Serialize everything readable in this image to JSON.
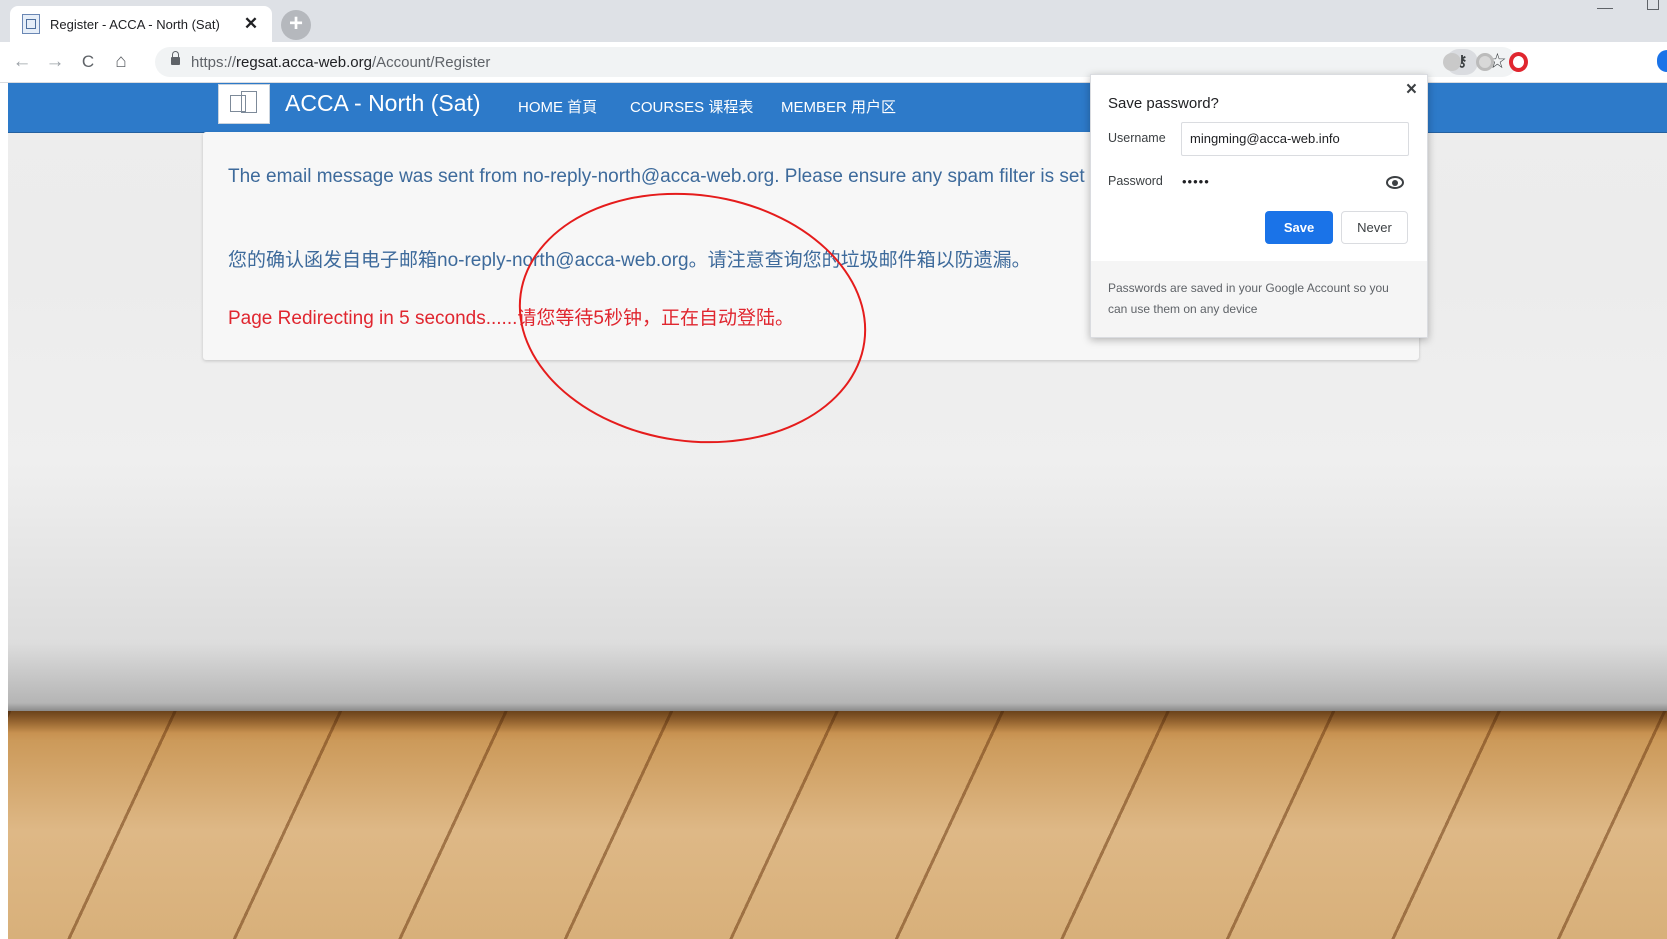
{
  "browser": {
    "tab": {
      "title": "Register - ACCA - North (Sat)",
      "close": "✕"
    },
    "newtab": "+",
    "nav": {
      "back": "←",
      "forward": "→",
      "reload": "C",
      "home": "⌂"
    },
    "url": {
      "scheme": "https://",
      "host": "regsat.acca-web.org",
      "path": "/Account/Register"
    },
    "toolbar_icons": {
      "key": "⚷",
      "star": "☆"
    }
  },
  "site": {
    "brand": "ACCA - North (Sat)",
    "nav": [
      {
        "label": "HOME 首頁"
      },
      {
        "label": "COURSES 课程表"
      },
      {
        "label": "MEMBER 用户区"
      }
    ]
  },
  "message": {
    "english": "The email message was sent from no-reply-north@acca-web.org. Please ensure any spam filter is set to allow mail from this address.",
    "chinese": "您的确认函发自电子邮箱no-reply-north@acca-web.org。请注意查询您的垃圾邮件箱以防遗漏。",
    "redirect": "Page Redirecting in 5 seconds......请您等待5秒钟，正在自动登陆。"
  },
  "save_password": {
    "title": "Save password?",
    "close": "×",
    "username_label": "Username",
    "username_value": "mingming@acca-web.info",
    "password_label": "Password",
    "password_value": "•••••",
    "save_button": "Save",
    "never_button": "Never",
    "footer": "Passwords are saved in your Google Account so you can use them on any device"
  },
  "colors": {
    "navbar": "#2d7ac9",
    "message_text": "#3d6a9b",
    "redirect_text": "#e0262f",
    "annotation_circle": "#e51c1c",
    "save_button": "#1a73e8"
  }
}
